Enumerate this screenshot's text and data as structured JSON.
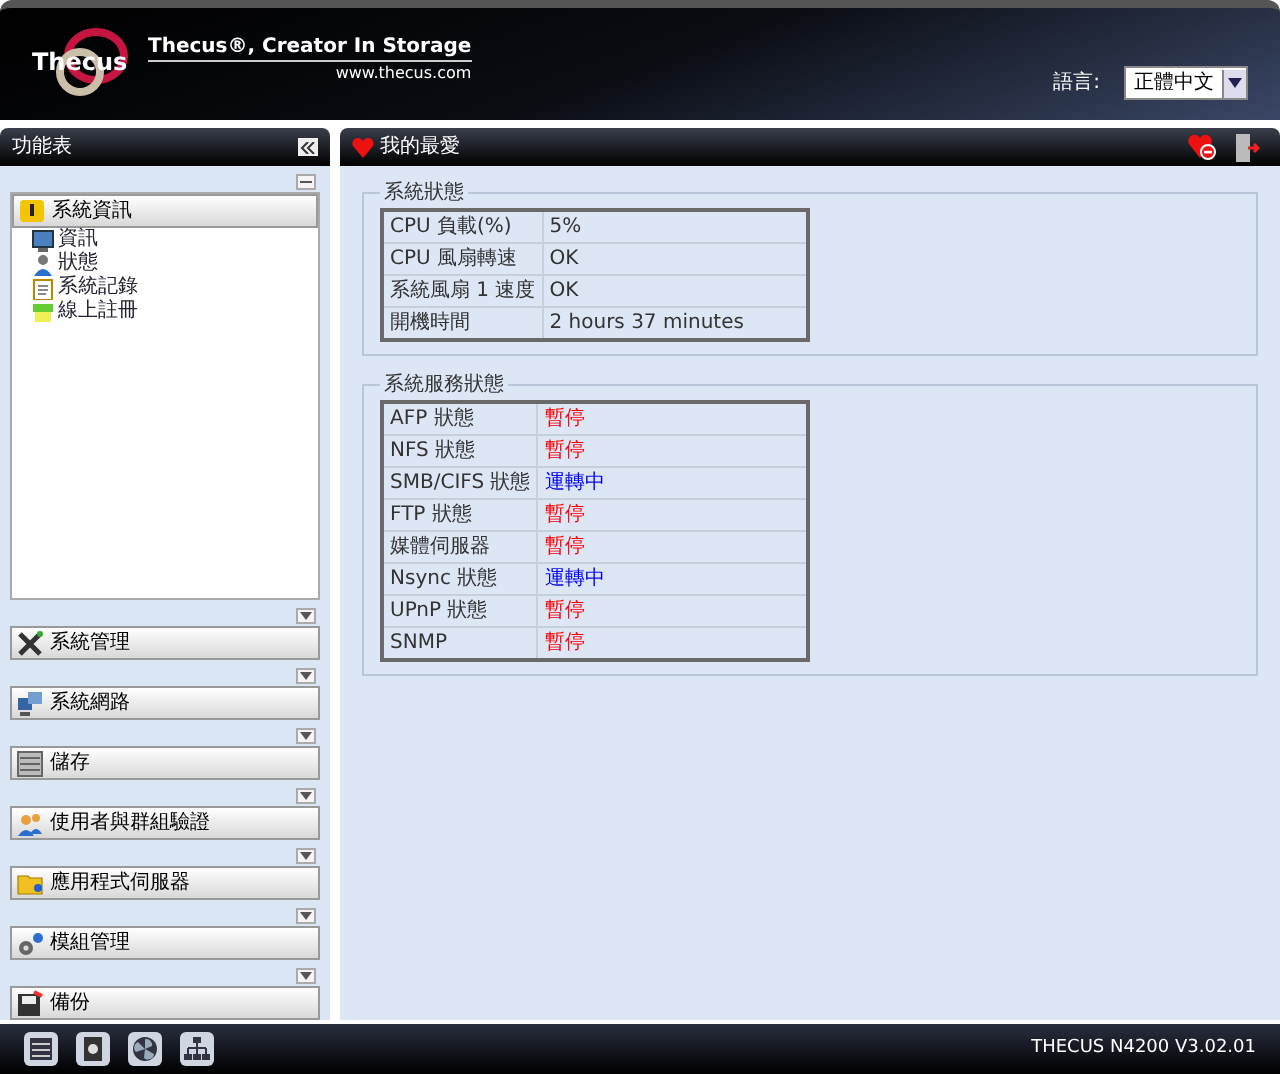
{
  "header": {
    "logo_word": "Thecus",
    "tagline": "Thecus®, Creator In Storage",
    "url": "www.thecus.com",
    "language_label": "語言:",
    "language_value": "正體中文"
  },
  "sidebar": {
    "title": "功能表",
    "sections": [
      {
        "label": "系統資訊",
        "expanded": true,
        "children": [
          {
            "label": "資訊"
          },
          {
            "label": "狀態"
          },
          {
            "label": "系統記錄"
          },
          {
            "label": "線上註冊"
          }
        ]
      },
      {
        "label": "系統管理",
        "expanded": false
      },
      {
        "label": "系統網路",
        "expanded": false
      },
      {
        "label": "儲存",
        "expanded": false
      },
      {
        "label": "使用者與群組驗證",
        "expanded": false
      },
      {
        "label": "應用程式伺服器",
        "expanded": false
      },
      {
        "label": "模組管理",
        "expanded": false
      },
      {
        "label": "備份",
        "expanded": false
      }
    ]
  },
  "main": {
    "title": "我的最愛",
    "groups": [
      {
        "title": "系統狀態",
        "rows": [
          {
            "name": "CPU 負載(%)",
            "value": "5%"
          },
          {
            "name": "CPU 風扇轉速",
            "value": "OK"
          },
          {
            "name": "系統風扇 1 速度",
            "value": "OK"
          },
          {
            "name": "開機時間",
            "value": "2 hours 37 minutes"
          }
        ]
      },
      {
        "title": "系統服務狀態",
        "rows": [
          {
            "name": "AFP 狀態",
            "value": "暫停",
            "color": "#ff0000"
          },
          {
            "name": "NFS 狀態",
            "value": "暫停",
            "color": "#ff0000"
          },
          {
            "name": "SMB/CIFS 狀態",
            "value": "運轉中",
            "color": "#0000ff"
          },
          {
            "name": "FTP 狀態",
            "value": "暫停",
            "color": "#ff0000"
          },
          {
            "name": "媒體伺服器",
            "value": "暫停",
            "color": "#ff0000"
          },
          {
            "name": "Nsync 狀態",
            "value": "運轉中",
            "color": "#0000ff"
          },
          {
            "name": "UPnP 狀態",
            "value": "暫停",
            "color": "#ff0000"
          },
          {
            "name": "SNMP",
            "value": "暫停",
            "color": "#ff0000"
          }
        ]
      }
    ]
  },
  "footer": {
    "version": "THECUS N4200 V3.02.01"
  }
}
